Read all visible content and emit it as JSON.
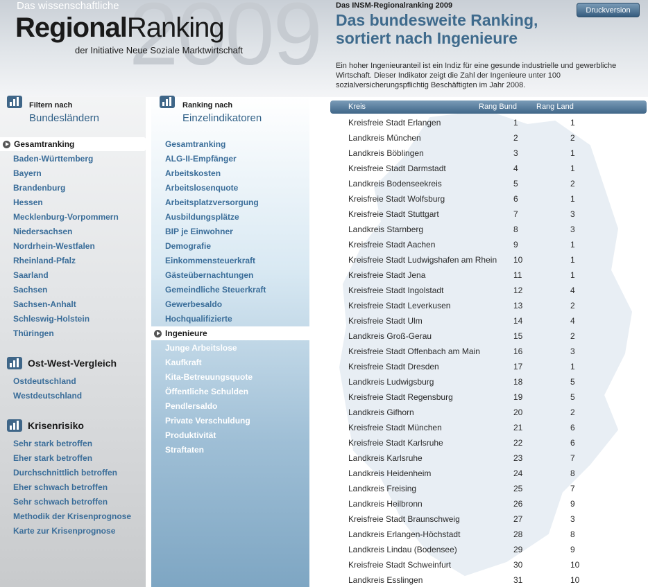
{
  "header": {
    "small_title": "Das wissenschaftliche",
    "brand_bold": "Regional",
    "brand_thin": "Ranking",
    "subtitle": "der Initiative Neue Soziale Marktwirtschaft",
    "year": "2009"
  },
  "page": {
    "kicker": "Das INSM-Regionalranking 2009",
    "title": "Das bundesweite Ranking, sortiert nach Ingenieure",
    "print_label": "Druckversion",
    "intro": "Ein hoher Ingenieuranteil ist ein Indiz für eine gesunde industrielle und gewerbliche Wirtschaft. Dieser Indikator zeigt die Zahl der Ingenieure unter 100 sozialversicherungspflichtig Beschäftigten im Jahr 2008."
  },
  "left": {
    "section1": {
      "line1": "Filtern nach",
      "line2": "Bundesländern"
    },
    "active": "Gesamtranking",
    "states": [
      "Baden-Württemberg",
      "Bayern",
      "Brandenburg",
      "Hessen",
      "Mecklenburg-Vorpommern",
      "Niedersachsen",
      "Nordrhein-Westfalen",
      "Rheinland-Pfalz",
      "Saarland",
      "Sachsen",
      "Sachsen-Anhalt",
      "Schleswig-Holstein",
      "Thüringen"
    ],
    "section2": {
      "label": "Ost-West-Vergleich"
    },
    "eastwest": [
      "Ostdeutschland",
      "Westdeutschland"
    ],
    "section3": {
      "label": "Krisenrisiko"
    },
    "crisis": [
      "Sehr stark betroffen",
      "Eher stark betroffen",
      "Durchschnittlich betroffen",
      "Eher schwach betroffen",
      "Sehr schwach betroffen",
      "Methodik der Krisenprognose",
      "Karte zur Krisenprognose"
    ]
  },
  "middle": {
    "section": {
      "line1": "Ranking nach",
      "line2": "Einzelindikatoren"
    },
    "items_before": [
      "Gesamtranking",
      "ALG-II-Empfänger",
      "Arbeitskosten",
      "Arbeitslosenquote",
      "Arbeitsplatzversorgung",
      "Ausbildungsplätze",
      "BIP je Einwohner",
      "Demografie",
      "Einkommensteuerkraft",
      "Gästeübernachtungen",
      "Gemeindliche Steuerkraft",
      "Gewerbesaldo",
      "Hochqualifizierte"
    ],
    "active": "Ingenieure",
    "items_after": [
      "Junge Arbeitslose",
      "Kaufkraft",
      "Kita-Betreuungsquote",
      "Öffentliche Schulden",
      "Pendlersaldo",
      "Private Verschuldung",
      "Produktivität",
      "Straftaten"
    ]
  },
  "table": {
    "headers": {
      "kreis": "Kreis",
      "bund": "Rang Bund",
      "land": "Rang Land"
    },
    "rows": [
      [
        "Kreisfreie Stadt Erlangen",
        "1",
        "1"
      ],
      [
        "Landkreis München",
        "2",
        "2"
      ],
      [
        "Landkreis Böblingen",
        "3",
        "1"
      ],
      [
        "Kreisfreie Stadt Darmstadt",
        "4",
        "1"
      ],
      [
        "Landkreis Bodenseekreis",
        "5",
        "2"
      ],
      [
        "Kreisfreie Stadt Wolfsburg",
        "6",
        "1"
      ],
      [
        "Kreisfreie Stadt Stuttgart",
        "7",
        "3"
      ],
      [
        "Landkreis Starnberg",
        "8",
        "3"
      ],
      [
        "Kreisfreie Stadt Aachen",
        "9",
        "1"
      ],
      [
        "Kreisfreie Stadt Ludwigshafen am Rhein",
        "10",
        "1"
      ],
      [
        "Kreisfreie Stadt Jena",
        "11",
        "1"
      ],
      [
        "Kreisfreie Stadt Ingolstadt",
        "12",
        "4"
      ],
      [
        "Kreisfreie Stadt Leverkusen",
        "13",
        "2"
      ],
      [
        "Kreisfreie Stadt Ulm",
        "14",
        "4"
      ],
      [
        "Landkreis Groß-Gerau",
        "15",
        "2"
      ],
      [
        "Kreisfreie Stadt Offenbach am Main",
        "16",
        "3"
      ],
      [
        "Kreisfreie Stadt Dresden",
        "17",
        "1"
      ],
      [
        "Landkreis Ludwigsburg",
        "18",
        "5"
      ],
      [
        "Kreisfreie Stadt Regensburg",
        "19",
        "5"
      ],
      [
        "Landkreis Gifhorn",
        "20",
        "2"
      ],
      [
        "Kreisfreie Stadt München",
        "21",
        "6"
      ],
      [
        "Kreisfreie Stadt Karlsruhe",
        "22",
        "6"
      ],
      [
        "Landkreis Karlsruhe",
        "23",
        "7"
      ],
      [
        "Landkreis Heidenheim",
        "24",
        "8"
      ],
      [
        "Landkreis Freising",
        "25",
        "7"
      ],
      [
        "Landkreis Heilbronn",
        "26",
        "9"
      ],
      [
        "Kreisfreie Stadt Braunschweig",
        "27",
        "3"
      ],
      [
        "Landkreis Erlangen-Höchstadt",
        "28",
        "8"
      ],
      [
        "Landkreis Lindau (Bodensee)",
        "29",
        "9"
      ],
      [
        "Kreisfreie Stadt Schweinfurt",
        "30",
        "10"
      ],
      [
        "Landkreis Esslingen",
        "31",
        "10"
      ]
    ]
  },
  "colors": {
    "link": "#3a6d99",
    "heading_blue": "#3e6a8c",
    "button": "#355c7e"
  }
}
